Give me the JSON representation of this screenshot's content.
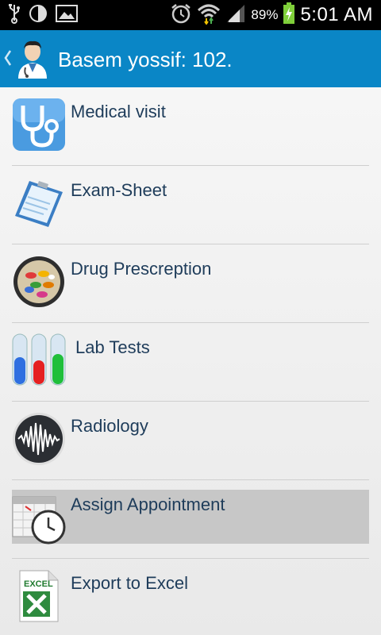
{
  "status_bar": {
    "battery_percent": "89%",
    "time": "5:01 AM",
    "icons_left": [
      "usb-icon",
      "half-moon-icon",
      "image-icon"
    ],
    "icons_right": [
      "alarm-icon",
      "wifi-icon",
      "signal-icon",
      "battery-charging-icon"
    ]
  },
  "action_bar": {
    "title": "Basem yossif: 102.",
    "color": "#0a86c6"
  },
  "menu": {
    "items": [
      {
        "label": "Medical visit",
        "icon": "stethoscope-icon"
      },
      {
        "label": "Exam-Sheet",
        "icon": "clipboard-icon"
      },
      {
        "label": "Drug Prescreption",
        "icon": "pills-icon"
      },
      {
        "label": "Lab Tests",
        "icon": "test-tubes-icon"
      },
      {
        "label": "Radiology",
        "icon": "waveform-icon"
      },
      {
        "label": "Assign Appointment",
        "icon": "calendar-clock-icon",
        "selected": true
      },
      {
        "label": "Export to Excel",
        "icon": "excel-icon"
      }
    ]
  }
}
